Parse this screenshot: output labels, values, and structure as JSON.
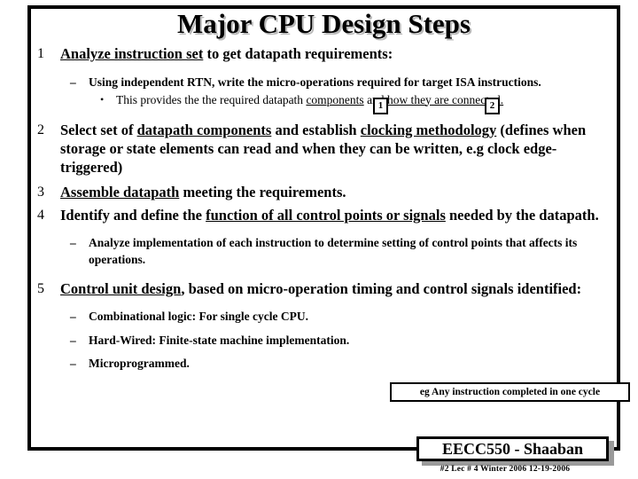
{
  "slide": {
    "title": "Major CPU Design Steps",
    "steps": [
      {
        "number": "1",
        "parts": [
          {
            "text": "Analyze instruction set",
            "underline": true
          },
          {
            "text": " to get datapath requirements:",
            "underline": false
          }
        ],
        "sub": [
          {
            "level": 2,
            "marker": "–",
            "parts": [
              {
                "text": "Using independent RTN, write the micro-operations required for target ISA instructions.",
                "underline": false
              }
            ]
          },
          {
            "level": 3,
            "marker": "•",
            "parts": [
              {
                "text": "This provides the the required datapath ",
                "underline": false
              },
              {
                "text": "components",
                "underline": true
              },
              {
                "text": " and ",
                "underline": false
              },
              {
                "text": "how they are connected.",
                "underline": true
              }
            ]
          }
        ]
      },
      {
        "number": "2",
        "parts": [
          {
            "text": "Select set of ",
            "underline": false
          },
          {
            "text": "datapath components",
            "underline": true
          },
          {
            "text": " and establish ",
            "underline": false
          },
          {
            "text": "clocking methodology",
            "underline": true
          },
          {
            "text": " (defines when storage or state elements can read and when they can be written, e.g clock edge-triggered)",
            "underline": false
          }
        ],
        "sub": []
      },
      {
        "number": "3",
        "parts": [
          {
            "text": "Assemble datapath",
            "underline": true
          },
          {
            "text": " meeting the requirements.",
            "underline": false
          }
        ],
        "sub": []
      },
      {
        "number": "4",
        "parts": [
          {
            "text": "Identify and define the ",
            "underline": false
          },
          {
            "text": "function of all control points or signals",
            "underline": true
          },
          {
            "text": " needed by the datapath.",
            "underline": false
          }
        ],
        "sub": [
          {
            "level": 2,
            "marker": "–",
            "parts": [
              {
                "text": "Analyze implementation of each instruction to determine setting of control points that affects its operations.",
                "underline": false
              }
            ]
          }
        ]
      },
      {
        "number": "5",
        "parts": [
          {
            "text": "Control unit design",
            "underline": true
          },
          {
            "text": ", based on micro-operation timing and control signals identified:",
            "underline": false
          }
        ],
        "sub": [
          {
            "level": 2,
            "marker": "–",
            "parts": [
              {
                "text": "Combinational logic: For single cycle CPU.",
                "underline": false
              }
            ]
          },
          {
            "level": 2,
            "marker": "–",
            "parts": [
              {
                "text": "Hard-Wired:  Finite-state machine implementation.",
                "underline": false
              }
            ]
          },
          {
            "level": 2,
            "marker": "–",
            "parts": [
              {
                "text": "Microprogrammed.",
                "underline": false
              }
            ]
          }
        ]
      }
    ],
    "callout_boxes": [
      {
        "label": "1"
      },
      {
        "label": "2"
      }
    ],
    "note_box": {
      "text": "eg Any instruction completed in one cycle"
    },
    "footer": {
      "banner": "EECC550 - Shaaban",
      "meta": "#2   Lec # 4   Winter 2006   12-19-2006"
    },
    "colors": {
      "background": "#ffffff",
      "text": "#000000",
      "border": "#000000",
      "title_shadow": "#b9b9b9",
      "banner_shadow": "#9a9a9a"
    }
  }
}
